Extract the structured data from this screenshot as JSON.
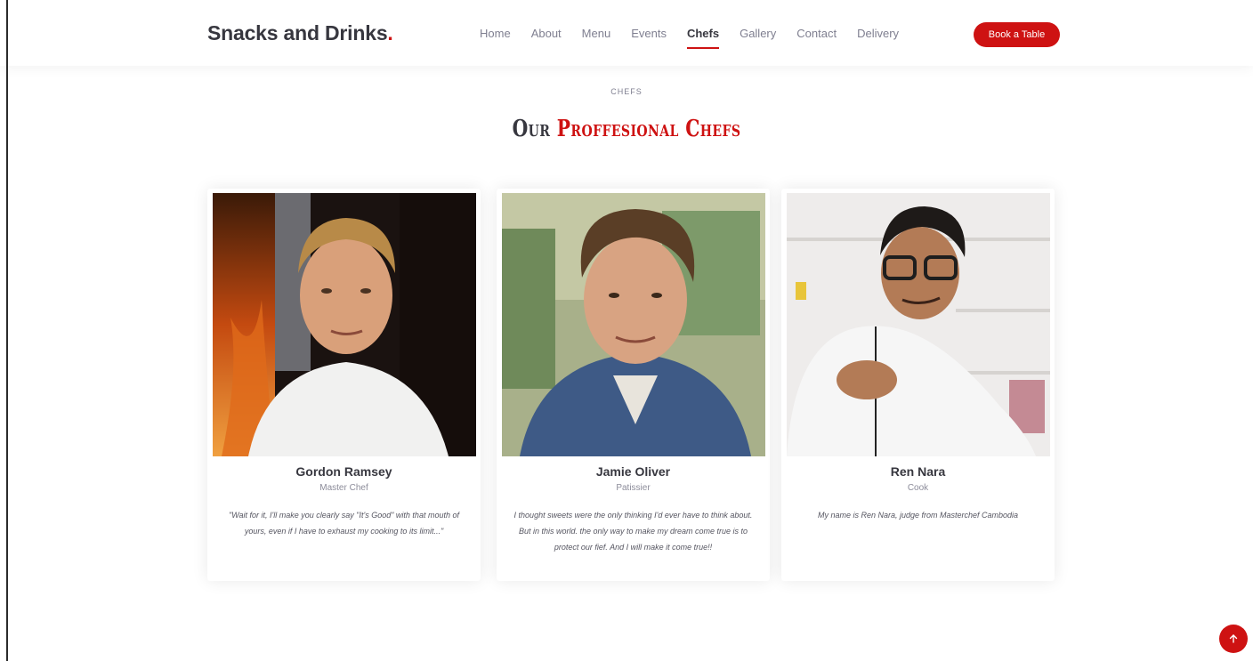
{
  "header": {
    "logo_text": "Snacks and Drinks",
    "logo_dot": ".",
    "nav": [
      "Home",
      "About",
      "Menu",
      "Events",
      "Chefs",
      "Gallery",
      "Contact",
      "Delivery"
    ],
    "active_nav": "Chefs",
    "book_button": "Book a Table"
  },
  "section": {
    "subtitle": "CHEFS",
    "title_plain": "Our",
    "title_accent": "Proffesional Chefs"
  },
  "chefs": [
    {
      "name": "Gordon Ramsey",
      "role": "Master Chef",
      "quote": "\"Wait for it, I'll make you clearly say \"It's Good\" with that mouth of yours, even if I have to exhaust my cooking to its limit...\""
    },
    {
      "name": "Jamie Oliver",
      "role": "Patissier",
      "quote": "I thought sweets were the only thinking I'd ever have to think about. But in this world. the only way to make my dream come true is to protect our fief. And I will make it come true!!"
    },
    {
      "name": "Ren Nara",
      "role": "Cook",
      "quote": "My name is Ren Nara, judge from Masterchef Cambodia"
    }
  ],
  "colors": {
    "accent": "#ce1212",
    "text_dark": "#37373f",
    "text_muted": "#7f7f90"
  },
  "icons": {
    "scroll_top": "arrow-up-icon"
  }
}
